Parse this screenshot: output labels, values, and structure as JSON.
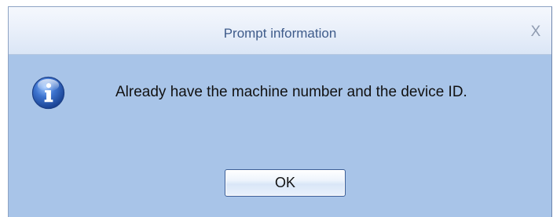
{
  "dialog": {
    "title": "Prompt information",
    "close_glyph": "X",
    "message": "Already have the machine number and the device ID.",
    "icon": "info-icon",
    "ok_label": "OK"
  },
  "colors": {
    "body_background": "#a8c4e8",
    "title_text": "#3e5b8a",
    "icon_blue": "#2f5fb5"
  }
}
